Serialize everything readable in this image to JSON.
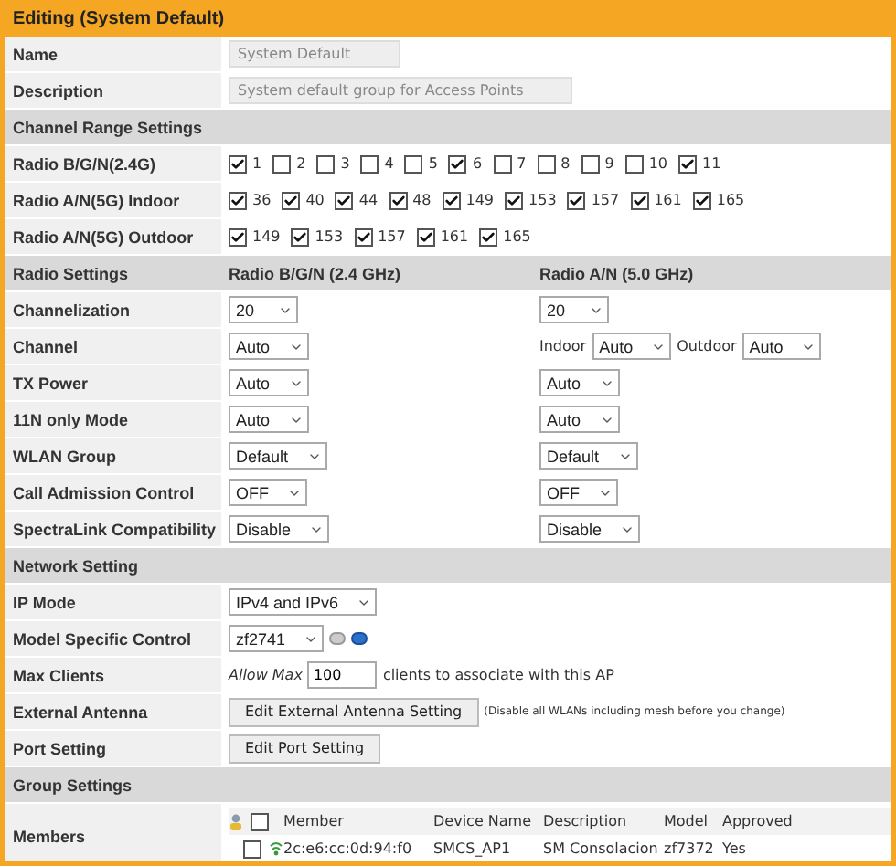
{
  "title": "Editing (System Default)",
  "rows": [
    {
      "kind": "field",
      "label": "Name",
      "value": "System Default",
      "disabled": true
    },
    {
      "kind": "field",
      "label": "Description",
      "value": "System default group for Access Points",
      "disabled": true
    },
    {
      "kind": "section",
      "title": "Channel Range Settings"
    },
    {
      "kind": "channels",
      "label": "Radio B/G/N(2.4G)",
      "channels": [
        {
          "label": "1",
          "checked": true
        },
        {
          "label": "2",
          "checked": false
        },
        {
          "label": "3",
          "checked": false
        },
        {
          "label": "4",
          "checked": false
        },
        {
          "label": "5",
          "checked": false
        },
        {
          "label": "6",
          "checked": true
        },
        {
          "label": "7",
          "checked": false
        },
        {
          "label": "8",
          "checked": false
        },
        {
          "label": "9",
          "checked": false
        },
        {
          "label": "10",
          "checked": false
        },
        {
          "label": "11",
          "checked": true
        }
      ]
    },
    {
      "kind": "channels",
      "label": "Radio A/N(5G) Indoor",
      "channels": [
        {
          "label": "36",
          "checked": true
        },
        {
          "label": "40",
          "checked": true
        },
        {
          "label": "44",
          "checked": true
        },
        {
          "label": "48",
          "checked": true
        },
        {
          "label": "149",
          "checked": true
        },
        {
          "label": "153",
          "checked": true
        },
        {
          "label": "157",
          "checked": true
        },
        {
          "label": "161",
          "checked": true
        },
        {
          "label": "165",
          "checked": true
        }
      ]
    },
    {
      "kind": "channels",
      "label": "Radio A/N(5G) Outdoor",
      "channels": [
        {
          "label": "149",
          "checked": true
        },
        {
          "label": "153",
          "checked": true
        },
        {
          "label": "157",
          "checked": true
        },
        {
          "label": "161",
          "checked": true
        },
        {
          "label": "165",
          "checked": true
        }
      ]
    },
    {
      "kind": "section",
      "title": "Radio Settings",
      "columns": [
        "Radio B/G/N (2.4 GHz)",
        "Radio A/N (5.0 GHz)"
      ]
    },
    {
      "kind": "dual",
      "label": "Channelization",
      "cells": [
        [
          {
            "kind": "select",
            "value": "20"
          }
        ],
        [
          {
            "kind": "select",
            "value": "20"
          }
        ]
      ]
    },
    {
      "kind": "dual",
      "label": "Channel",
      "cells": [
        [
          {
            "kind": "select",
            "value": "Auto"
          }
        ],
        [
          {
            "kind": "text",
            "text": "Indoor"
          },
          {
            "kind": "select",
            "value": "Auto"
          },
          {
            "kind": "text",
            "text": "Outdoor"
          },
          {
            "kind": "select",
            "value": "Auto"
          }
        ]
      ]
    },
    {
      "kind": "dual",
      "label": "TX Power",
      "cells": [
        [
          {
            "kind": "select",
            "value": "Auto"
          }
        ],
        [
          {
            "kind": "select",
            "value": "Auto"
          }
        ]
      ]
    },
    {
      "kind": "dual",
      "label": "11N only Mode",
      "cells": [
        [
          {
            "kind": "select",
            "value": "Auto"
          }
        ],
        [
          {
            "kind": "select",
            "value": "Auto"
          }
        ]
      ]
    },
    {
      "kind": "dual",
      "label": "WLAN Group",
      "cells": [
        [
          {
            "kind": "select",
            "value": "Default"
          }
        ],
        [
          {
            "kind": "select",
            "value": "Default"
          }
        ]
      ]
    },
    {
      "kind": "dual",
      "label": "Call Admission Control",
      "cells": [
        [
          {
            "kind": "select",
            "value": "OFF"
          }
        ],
        [
          {
            "kind": "select",
            "value": "OFF"
          }
        ]
      ]
    },
    {
      "kind": "dual",
      "label": "SpectraLink Compatibility",
      "cells": [
        [
          {
            "kind": "select",
            "value": "Disable"
          }
        ],
        [
          {
            "kind": "select",
            "value": "Disable"
          }
        ]
      ]
    },
    {
      "kind": "section",
      "title": "Network Setting"
    },
    {
      "kind": "single",
      "label": "IP Mode",
      "parts": [
        {
          "kind": "select",
          "value": "IPv4 and IPv6"
        }
      ]
    },
    {
      "kind": "single",
      "label": "Model Specific Control",
      "parts": [
        {
          "kind": "select",
          "value": "zf2741"
        },
        {
          "kind": "icons"
        }
      ]
    },
    {
      "kind": "single",
      "label": "Max Clients",
      "parts": [
        {
          "kind": "italic",
          "text": "Allow Max"
        },
        {
          "kind": "input",
          "value": "100"
        },
        {
          "kind": "text",
          "text": "clients to associate with this AP"
        }
      ]
    },
    {
      "kind": "single",
      "label": "External Antenna",
      "parts": [
        {
          "kind": "button",
          "text": "Edit External Antenna Setting"
        },
        {
          "kind": "note",
          "text": "(Disable all WLANs including mesh before you change)"
        }
      ]
    },
    {
      "kind": "single",
      "label": "Port Setting",
      "parts": [
        {
          "kind": "button",
          "text": "Edit Port Setting"
        }
      ]
    },
    {
      "kind": "section",
      "title": "Group Settings"
    },
    {
      "kind": "members",
      "label": "Members",
      "columns": [
        "Member",
        "Device Name",
        "Description",
        "Model",
        "Approved"
      ],
      "all_checked": false,
      "members": [
        {
          "checked": false,
          "cells": [
            "2c:e6:cc:0d:94:f0",
            "SMCS_AP1",
            "SM Consolacion",
            "zf7372",
            "Yes"
          ]
        }
      ]
    }
  ]
}
